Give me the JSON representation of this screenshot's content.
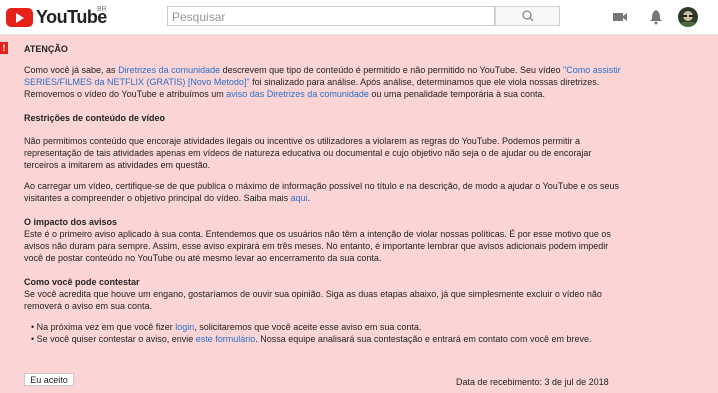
{
  "header": {
    "logo": "YouTube",
    "region": "BR",
    "search_placeholder": "Pesquisar"
  },
  "title": "ATENÇÃO",
  "p1": {
    "a": "Como você já sabe, as ",
    "link1": "Diretrizes da comunidade",
    "b": " descrevem que tipo de conteúdo é permitido e não permitido no YouTube. Seu vídeo ",
    "link2": "\"Como assistir SERIES/FILMES da NETFLIX (GRATIS) [Novo Metodo]\"",
    "c": " foi sinalizado para análise. Após análise, determinamos que ele viola nossas diretrizes. Removemos o vídeo do YouTube e atribuímos um ",
    "link3": "aviso das Diretrizes da comunidade",
    "d": " ou uma penalidade temporária à sua conta."
  },
  "h_restricoes": "Restrições de conteúdo de vídeo",
  "p2": "Não permitimos conteúdo que encoraje atividades ilegais ou incentive os utilizadores a violarem as regras do YouTube. Podemos permitir a representação de tais atividades apenas em vídeos de natureza educativa ou documental e cujo objetivo não seja o de ajudar ou de encorajar terceiros a imitarem as atividades em questão.",
  "p3": {
    "a": "Ao carregar um vídeo, certifique-se de que publica o máximo de informação possível no título e na descrição, de modo a ajudar o YouTube e os seus visitantes a compreender o objetivo principal do vídeo. Saiba mais ",
    "link": "aqui",
    "b": "."
  },
  "h_impacto": "O impacto dos avisos",
  "p4": "Este é o primeiro aviso aplicado à sua conta. Entendemos que os usuários não têm a intenção de violar nossas políticas. É por esse motivo que os avisos não duram para sempre. Assim, esse aviso expirará em três meses. No entanto, é importante lembrar que avisos adicionais podem impedir você de postar conteúdo no YouTube ou até mesmo levar ao encerramento da sua conta.",
  "h_contestar": "Como você pode contestar",
  "p5": "Se você acredita que houve um engano, gostaríamos de ouvir sua opinião. Siga as duas etapas abaixo, já que simplesmente excluir o vídeo não removerá o aviso em sua conta.",
  "li1": {
    "a": "Na próxima vez em que você fizer ",
    "link": "login",
    "b": ", solicitaremos que você aceite esse aviso em sua conta."
  },
  "li2": {
    "a": "Se você quiser contestar o aviso, envie ",
    "link": "este formulário",
    "b": ". Nossa equipe analisará sua contestação e entrará em contato com você em breve."
  },
  "button": "Eu aceito",
  "date": "Data de recebimento: 3 de jul de 2018"
}
